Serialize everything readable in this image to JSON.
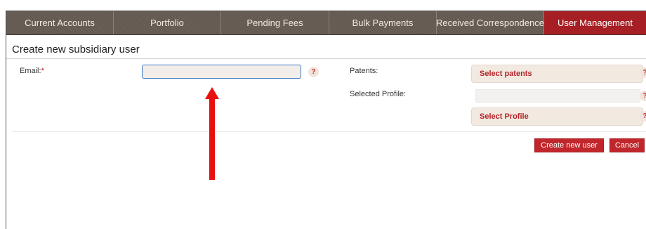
{
  "nav": {
    "tabs": [
      {
        "label": "Current Accounts",
        "active": false
      },
      {
        "label": "Portfolio",
        "active": false
      },
      {
        "label": "Pending Fees",
        "active": false
      },
      {
        "label": "Bulk Payments",
        "active": false
      },
      {
        "label": "Received Correspondence",
        "active": false
      },
      {
        "label": "User Management",
        "active": true
      }
    ]
  },
  "page": {
    "title": "Create new subsidiary user"
  },
  "form": {
    "email_label": "Email:",
    "required_marker": "*",
    "email_value": "",
    "help_glyph": "?",
    "patents_label": "Patents:",
    "select_patents_label": "Select patents",
    "selected_profile_label": "Selected Profile:",
    "selected_profile_value": "",
    "select_profile_label": "Select Profile"
  },
  "actions": {
    "create_label": "Create new user",
    "cancel_label": "Cancel"
  },
  "colors": {
    "nav_bg": "#645b54",
    "active_tab": "#a61f24",
    "button": "#c0262b",
    "annotation_arrow": "#e8100f"
  }
}
